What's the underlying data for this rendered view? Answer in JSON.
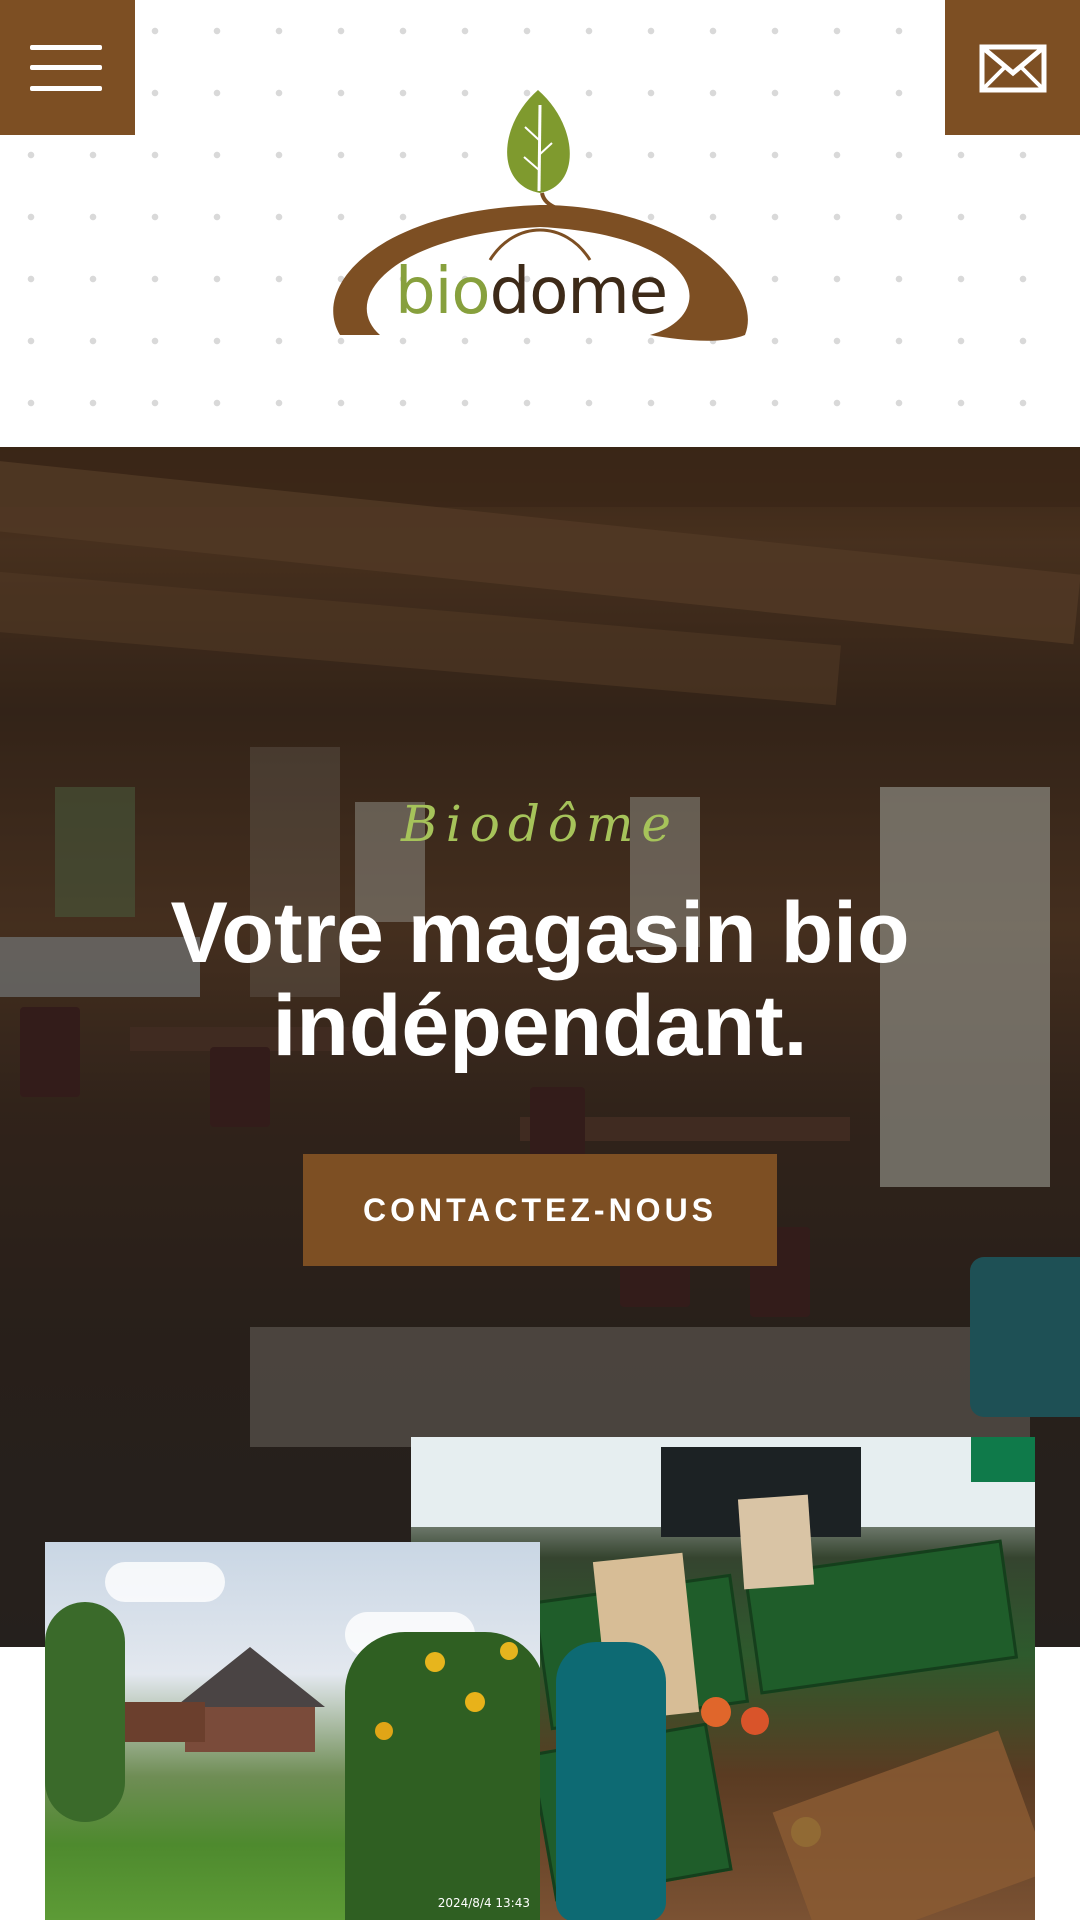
{
  "header": {
    "logo": {
      "text_bio": "bio",
      "text_dome": "dome",
      "leaf_color": "#7f9a2e",
      "swoosh_color": "#7d4f23"
    },
    "menu_icon": "hamburger-menu-icon",
    "mail_icon": "envelope-icon"
  },
  "hero": {
    "script_title": "Biodôme",
    "title": "Votre magasin bio indépendant.",
    "cta_label": "CONTACTEZ-NOUS"
  },
  "photos": {
    "house_timestamp": "2024/8/4  13:43"
  },
  "colors": {
    "brand_brown": "#7d4f23",
    "brand_green": "#87a03d",
    "script_green": "#a6c35a"
  }
}
